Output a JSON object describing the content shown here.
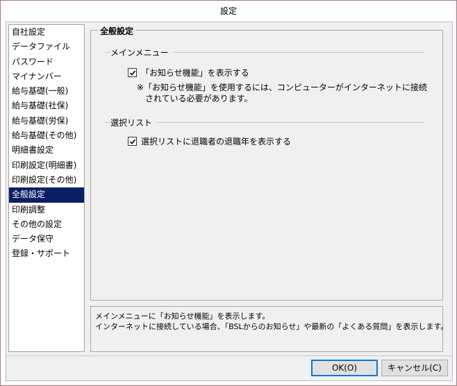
{
  "window": {
    "title": "設定"
  },
  "sidebar": {
    "items": [
      {
        "label": "自社設定"
      },
      {
        "label": "データファイル"
      },
      {
        "label": "パスワード"
      },
      {
        "label": "マイナンバー"
      },
      {
        "label": "給与基礎(一般)"
      },
      {
        "label": "給与基礎(社保)"
      },
      {
        "label": "給与基礎(労保)"
      },
      {
        "label": "給与基礎(その他)"
      },
      {
        "label": "明細書設定"
      },
      {
        "label": "印刷設定(明細書)"
      },
      {
        "label": "印刷設定(その他)"
      },
      {
        "label": "全般設定",
        "selected": true
      },
      {
        "label": "印刷調整"
      },
      {
        "label": "その他の設定"
      },
      {
        "label": "データ保守"
      },
      {
        "label": "登録・サポート"
      }
    ]
  },
  "panel": {
    "title": "全般設定",
    "main_menu": {
      "section_label": "メインメニュー",
      "checkbox_label": "「お知らせ機能」を表示する",
      "checked": true,
      "note_line1": "※「お知らせ機能」を使用するには、コンピューターがインターネットに接続",
      "note_line2": "されている必要があります。"
    },
    "select_list": {
      "section_label": "選択リスト",
      "checkbox_label": "選択リストに退職者の退職年を表示する",
      "checked": true
    }
  },
  "description": {
    "line1": "メインメニューに「お知らせ機能」を表示します。",
    "line2": "インターネットに接続している場合、「BSLからのお知らせ」や最新の「よくある質問」を表示します。"
  },
  "buttons": {
    "ok": "OK(O)",
    "cancel": "キャンセル(C)"
  }
}
